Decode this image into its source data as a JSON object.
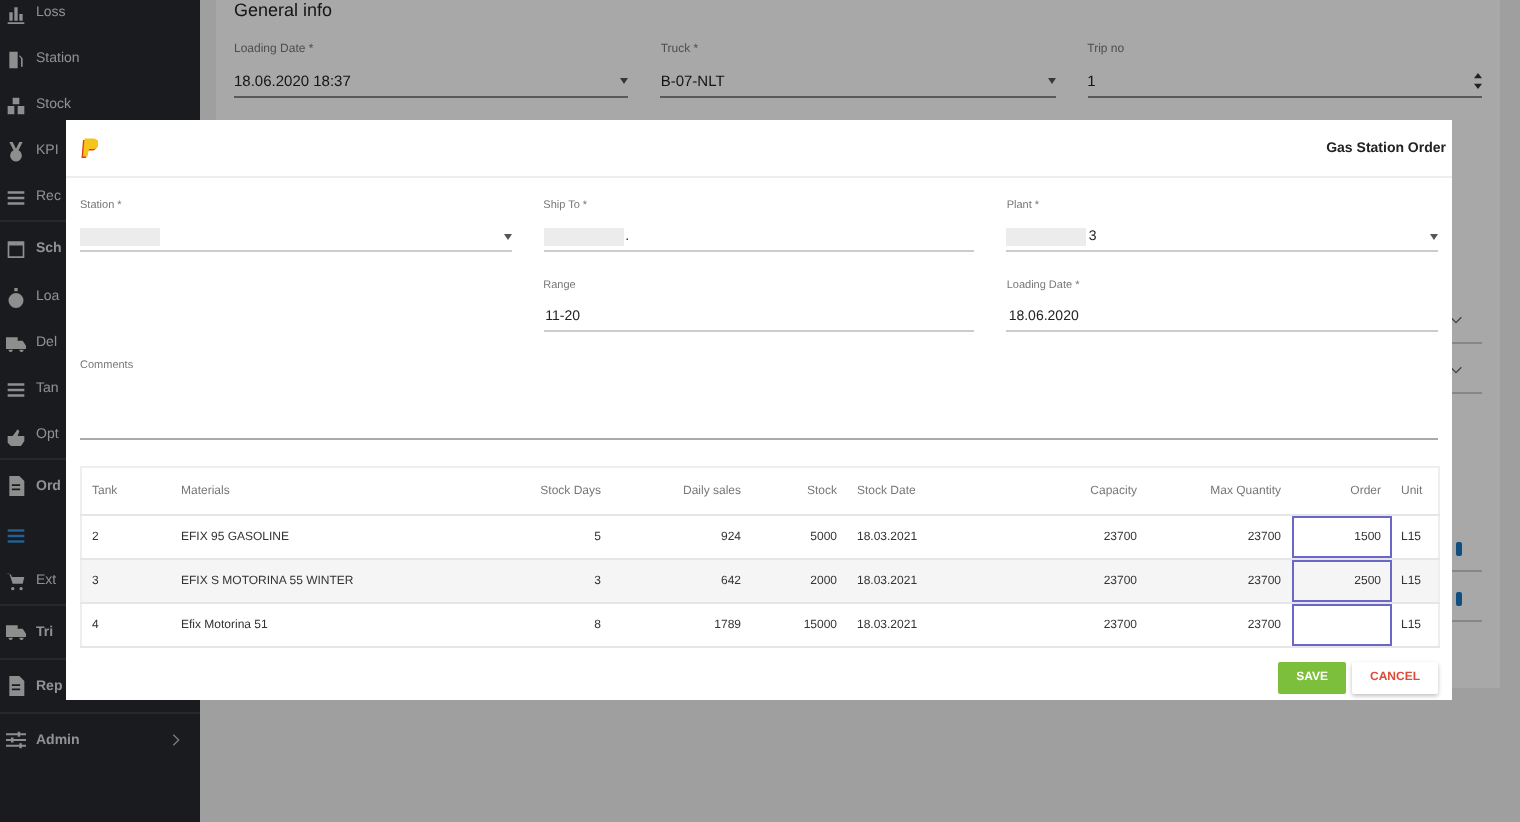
{
  "sidebar": {
    "items": [
      {
        "label": "Loss",
        "kind": "item",
        "selected": false
      },
      {
        "label": "Station",
        "kind": "item",
        "selected": false
      },
      {
        "label": "Stock",
        "kind": "item",
        "selected": false
      },
      {
        "label": "KPI",
        "kind": "item",
        "selected": false
      },
      {
        "label": "Rec",
        "kind": "item",
        "selected": false
      },
      {
        "label": "Sch",
        "kind": "section",
        "selected": false
      },
      {
        "label": "Loa",
        "kind": "item",
        "selected": false
      },
      {
        "label": "Del",
        "kind": "item",
        "selected": false
      },
      {
        "label": "Tan",
        "kind": "item",
        "selected": false
      },
      {
        "label": "Opt",
        "kind": "item",
        "selected": false
      },
      {
        "label": "Ord",
        "kind": "section",
        "selected": false
      },
      {
        "kind": "item",
        "selected": true
      },
      {
        "label": "Ext",
        "kind": "item",
        "selected": false
      },
      {
        "label": "Tri",
        "kind": "section",
        "selected": false
      },
      {
        "label": "Rep",
        "kind": "section",
        "selected": false
      },
      {
        "label": "Admin",
        "kind": "section",
        "selected": false,
        "expandable": true
      }
    ]
  },
  "background_form": {
    "title": "General info",
    "fields": [
      {
        "label": "Loading Date *",
        "value": "18.06.2020 18:37",
        "kind": "select"
      },
      {
        "label": "Truck *",
        "value": "B-07-NLT",
        "kind": "select"
      },
      {
        "label": "Trip no",
        "value": "1",
        "kind": "spinner"
      }
    ],
    "rows": [
      {
        "kind": "expand"
      },
      {
        "kind": "expand"
      },
      {
        "kind": "status"
      },
      {
        "kind": "status"
      }
    ]
  },
  "modal": {
    "title": "Gas Station Order",
    "fields": [
      {
        "label": "Station *",
        "kind": "select",
        "redacted": true
      },
      {
        "label": "Ship To *",
        "value": ".",
        "kind": "text",
        "redacted": true
      },
      {
        "label": "Plant *",
        "value": "3",
        "kind": "select",
        "redacted": true
      },
      {
        "label": "Range",
        "value": "11-20",
        "kind": "text"
      },
      {
        "label": "Loading Date *",
        "value": "18.06.2020",
        "kind": "text"
      },
      {
        "label": "Comments",
        "kind": "textarea"
      }
    ],
    "table": {
      "columns": [
        "Tank",
        "Materials",
        "Stock Days",
        "Daily sales",
        "Stock",
        "Stock Date",
        "Capacity",
        "Max Quantity",
        "Order",
        "Unit"
      ],
      "rows": [
        {
          "tank": "2",
          "material": "EFIX 95 GASOLINE",
          "stock_days": "5",
          "daily_sales": "924",
          "stock": "5000",
          "stock_date": "18.03.2021",
          "capacity": "23700",
          "max_quantity": "23700",
          "order": "1500",
          "unit": "L15"
        },
        {
          "tank": "3",
          "material": "EFIX S MOTORINA 55 WINTER",
          "stock_days": "3",
          "daily_sales": "642",
          "stock": "2000",
          "stock_date": "18.03.2021",
          "capacity": "23700",
          "max_quantity": "23700",
          "order": "2500",
          "unit": "L15"
        },
        {
          "tank": "4",
          "material": "Efix Motorina 51",
          "stock_days": "8",
          "daily_sales": "1789",
          "stock": "15000",
          "stock_date": "18.03.2021",
          "capacity": "23700",
          "max_quantity": "23700",
          "unit": "L15"
        }
      ]
    },
    "buttons": [
      {
        "label": "SAVE",
        "kind": "primary"
      },
      {
        "label": "CANCEL",
        "kind": "secondary"
      }
    ]
  }
}
